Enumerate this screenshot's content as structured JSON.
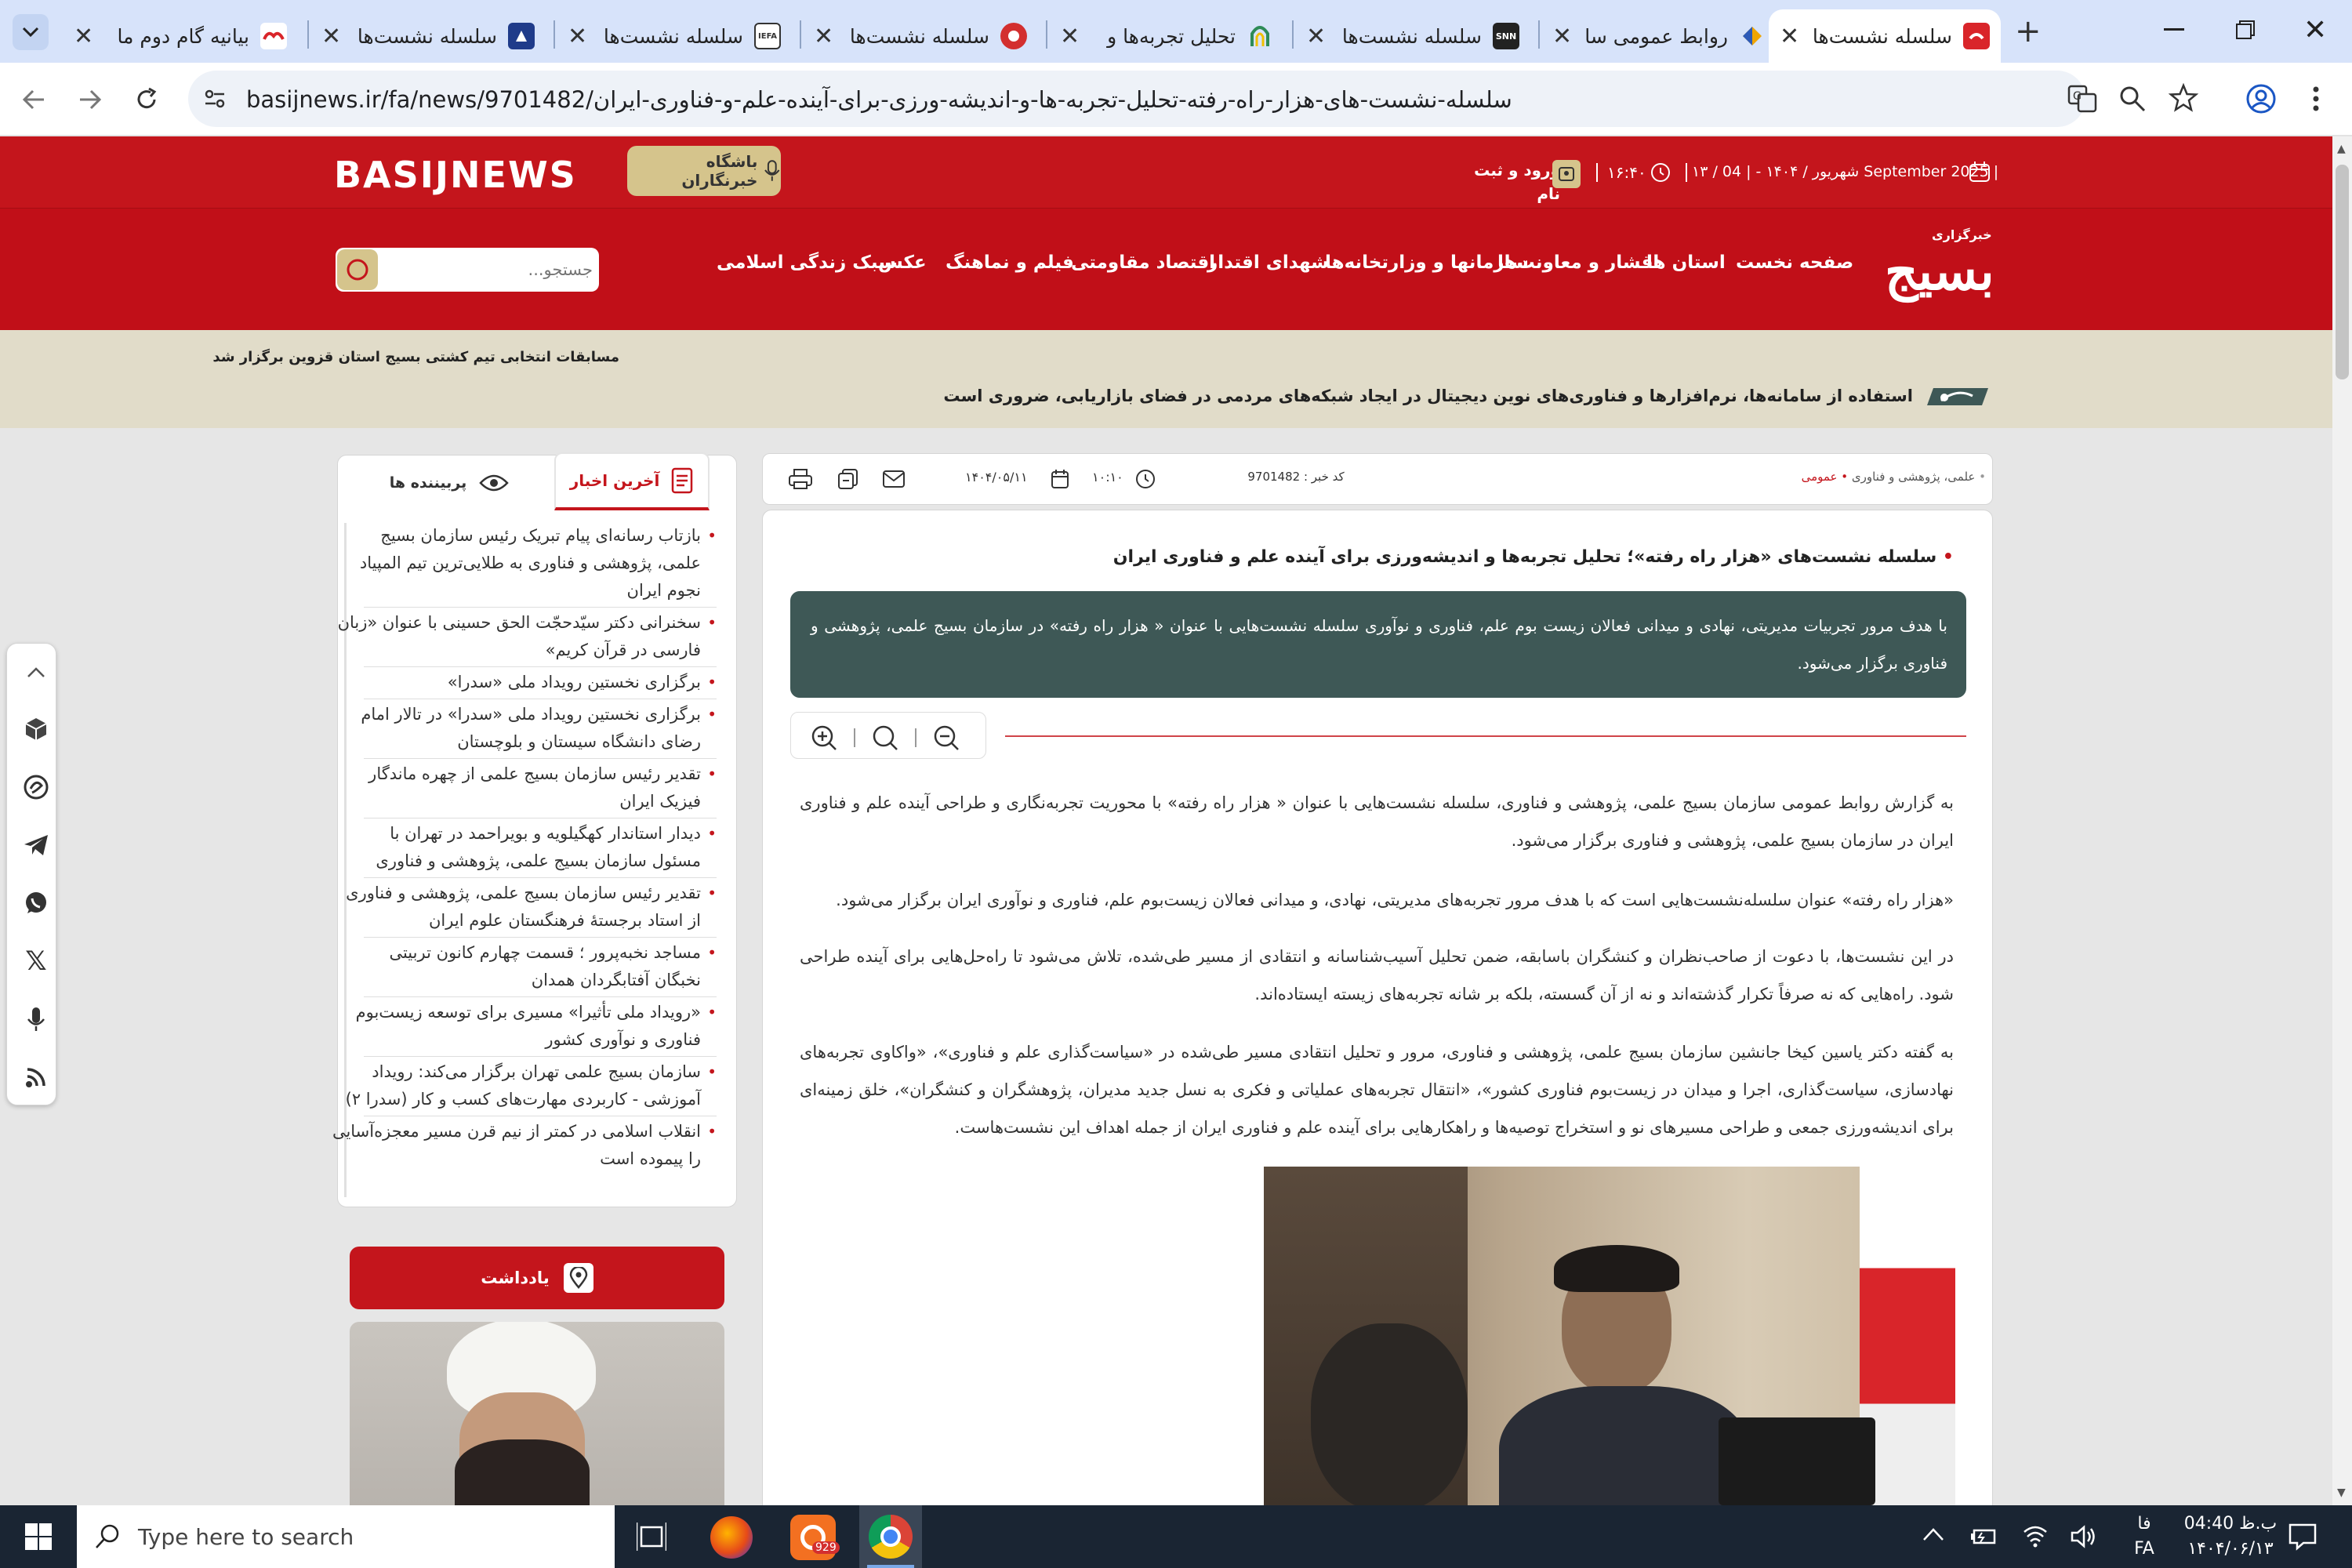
{
  "browser": {
    "tabs": [
      {
        "title": "سلسله نشست‌ها",
        "active": true,
        "favicon": "basij-icon",
        "color": "#d9252a"
      },
      {
        "title": "روابط عمومی سا",
        "favicon": "diamond-icon",
        "color": "#f0a500"
      },
      {
        "title": "سلسله نشست‌ها",
        "favicon": "snn-icon",
        "color": "#222222"
      },
      {
        "title": "تحلیل تجربه‌ها و",
        "favicon": "arch-icon",
        "color": "#2e8b57"
      },
      {
        "title": "سلسله نشست‌ها",
        "favicon": "circle-red-icon",
        "color": "#d32f2f"
      },
      {
        "title": "سلسله نشست‌ها",
        "favicon": "iefa-icon",
        "color": "#333333"
      },
      {
        "title": "سلسله نشست‌ها",
        "favicon": "emblem-icon",
        "color": "#1f3b8a"
      },
      {
        "title": "بیانیه گام دوم ما",
        "favicon": "emblem-red-icon",
        "color": "#d9252a"
      }
    ],
    "url": "basijnews.ir/fa/news/9701482/سلسله-نشست-های-هزار-راه-رفته-تحلیل-تجربه-ها-و-اندیشه-ورزی-برای-آینده-علم-و-فناوری-ایران"
  },
  "site": {
    "logo_text": "BASIJNEWS",
    "reporters_club": "باشگاه خبرنگاران",
    "login": "ورود و ثبت",
    "login2": "نام",
    "time": "۱۶:۴۰",
    "date": "۱۳ / شهریور / ۱۴۰۴ - | 04 September 2025 |",
    "brand_small": "خبرگزاری",
    "brand_big": "بسیج",
    "search_placeholder": "جستجو...",
    "nav": [
      "صفحه نخست",
      "استان ها",
      "اقشار و معاونت‌ها",
      "سازمانها و وزارتخانه‌ها",
      "شهدای اقتدار",
      "اقتصاد مقاومتی",
      "فیلم و نماهنگ",
      "عکس",
      "سبک زندگی اسلامی"
    ],
    "ticker_main": "استفاده از سامانه‌ها، نرم‌افزارها و فناوری‌های نوین دیجیتال در ایجاد شبکه‌های مردمی در فضای بازاریابی، ضروری است",
    "ticker_left": "مسابقات انتخابی تیم کشتی بسیج استان قزوین برگزار شد"
  },
  "article": {
    "breadcrumb": "علمی، پژوهشی و فناوری",
    "category": "عمومی",
    "news_code": "کد خبر : 9701482",
    "date": "۱۴۰۴/۰۵/۱۱",
    "time": "۱۰:۱۰",
    "title": "سلسله نشست‌های «هزار راه رفته»؛ تحلیل تجربه‌ها و اندیشه‌ورزی برای آینده علم و فناوری ایران",
    "lead": "با هدف مرور تجربیات مدیریتی، نهادی و میدانی فعالان زیست بوم علم، فناوری و نوآوری سلسله نشست‌هایی با عنوان « هزار راه رفته» در سازمان بسیج علمی، پژوهشی و فناوری برگزار می‌شود.",
    "paragraphs": [
      "به گزارش روابط عمومی سازمان بسیج علمی، پژوهشی و فناوری، سلسله نشست‌هایی با عنوان « هزار راه رفته» با محوریت تجربه‌نگاری و طراحی آینده علم و فناوری ایران در سازمان بسیج علمی، پژوهشی و فناوری برگزار می‌شود.",
      "«هزار راه رفته» عنوان سلسله‌نشست‌هایی است که با هدف مرور تجربه‌های مدیریتی، نهادی، و میدانی فعالان زیست‌بوم علم، فناوری و نوآوری ایران برگزار می‌شود.",
      "در این نشست‌ها، با دعوت از صاحب‌نظران و کنشگران باسابقه، ضمن تحلیل آسیب‌شناسانه و انتقادی از مسیر طی‌شده، تلاش می‌شود تا راه‌حل‌هایی برای آینده طراحی شود. راه‌هایی که نه صرفاً تکرار گذشته‌اند و نه از آن گسسته، بلکه بر شانه تجربه‌های زیسته ایستاده‌اند.",
      "به گفته دکتر یاسین کیخا جانشین سازمان بسیج علمی، پژوهشی و فناوری، مرور و تحلیل انتقادی مسیر طی‌شده در «سیاست‌گذاری علم و فناوری»، «واکاوی تجربه‌های نهادسازی، سیاست‌گذاری، اجرا و میدان در زیست‌بوم فناوری کشور»، «انتقال تجربه‌های عملیاتی و فکری به نسل جدید مدیران، پژوهشگران و کنشگران»، خلق زمینه‌ای برای اندیشه‌ورزی جمعی و طراحی مسیرهای نو و استخراج توصیه‌ها و راهکارهایی برای آینده علم و فناوری ایران از جمله اهداف این نشست‌هاست."
    ]
  },
  "sidebar": {
    "tab_latest": "آخرین اخبار",
    "tab_popular": "پربیننده ها",
    "news": [
      [
        "بازتاب رسانه‌ای پیام تبریک رئیس سازمان بسیج",
        "علمی، پژوهشی و فناوری به طلایی‌ترین تیم المپیاد",
        "نجوم ایران"
      ],
      [
        "سخنرانی دکتر سیّدحجّت الحق حسینی با عنوان «زبان",
        "فارسی در قرآن کریم»"
      ],
      [
        "برگزاری نخستین رویداد ملی «سدرا»"
      ],
      [
        "برگزاری نخستین رویداد ملی «سدرا» در تالار امام",
        "رضای دانشگاه سیستان و بلوچستان"
      ],
      [
        "تقدیر رئیس سازمان بسیج علمی از چهره ماندگار",
        "فیزیک ایران"
      ],
      [
        "دیدار استاندار کهگیلویه و بویراحمد در تهران با",
        "مسئول سازمان بسیج علمی، پژوهشی و فناوری"
      ],
      [
        "تقدیر رئیس سازمان بسیج علمی، پژوهشی و فناوری",
        "از استاد برجستهٔ فرهنگستان علوم ایران"
      ],
      [
        "مساجد نخبه‌پرور ؛ قسمت چهارم کانون تربیتی",
        "نخبگان آفتابگردان همدان"
      ],
      [
        "«رویداد ملی تأثیرا» مسیری برای توسعه زیست‌بوم",
        "فناوری و نوآوری کشور"
      ],
      [
        "سازمان بسیج علمی تهران برگزار می‌کند: رویداد",
        "آموزشی - کاربردی مهارت‌های کسب و کار (سدرا ۲)"
      ],
      [
        "انقلاب اسلامی در کمتر از نیم قرن مسیر معجزه‌آسایی",
        "را پیموده است"
      ]
    ],
    "note_label": "یادداشت"
  },
  "taskbar": {
    "search_placeholder": "Type here to search",
    "time": "ب.ظ 04:40",
    "date": "۱۴۰۴/۰۶/۱۳",
    "lang_top": "فا",
    "lang_bottom": "FA",
    "badge": "929"
  },
  "colors": {
    "brand": "#c4151c",
    "lead_bg": "#3e5856",
    "ticker_bg": "#e1dcc9"
  }
}
